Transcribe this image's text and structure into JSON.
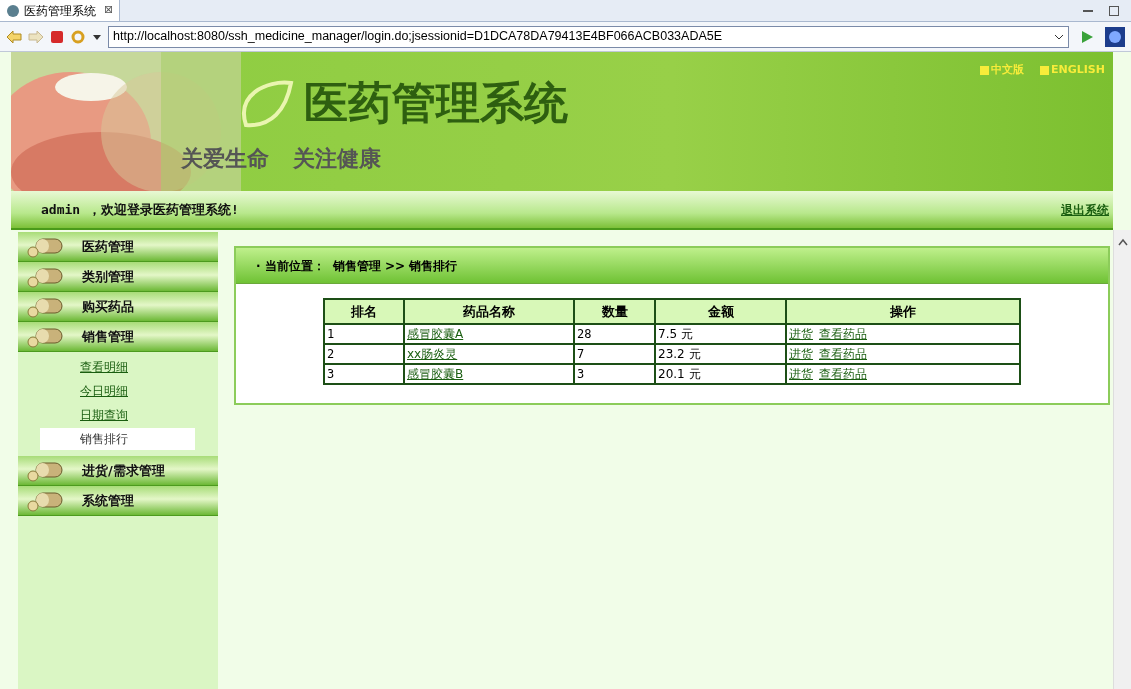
{
  "browser": {
    "tab_title": "医药管理系统",
    "tab_close": "⊠",
    "address": "http://localhost:8080/ssh_medicine_manager/login.do;jsessionid=D1DCA78DA79413E4BF066ACB033ADA5E"
  },
  "banner": {
    "title": "医药管理系统",
    "slogans": [
      "关爱生命",
      "关注健康"
    ],
    "languages": [
      "中文版",
      "ENGLISH"
    ]
  },
  "welcome_bar": {
    "message": "admin ，欢迎登录医药管理系统!",
    "logout": "退出系统"
  },
  "sidebar": {
    "items": [
      {
        "label": "医药管理"
      },
      {
        "label": "类别管理"
      },
      {
        "label": "购买药品"
      },
      {
        "label": "销售管理",
        "children": [
          {
            "label": "查看明细",
            "selected": false
          },
          {
            "label": "今日明细",
            "selected": false
          },
          {
            "label": "日期查询",
            "selected": false
          },
          {
            "label": "销售排行",
            "selected": true
          }
        ]
      },
      {
        "label": "进货/需求管理"
      },
      {
        "label": "系统管理"
      }
    ]
  },
  "breadcrumb": {
    "prefix": "· 当前位置：",
    "path": "销售管理 >> 销售排行"
  },
  "table": {
    "columns": [
      "排名",
      "药品名称",
      "数量",
      "金额",
      "操作"
    ],
    "rows": [
      {
        "rank": "1",
        "name": "感冒胶囊A",
        "quantity": "28",
        "amount": "7.5 元",
        "actions": [
          "进货",
          "查看药品"
        ]
      },
      {
        "rank": "2",
        "name": "xx肠炎灵",
        "quantity": "7",
        "amount": "23.2 元",
        "actions": [
          "进货",
          "查看药品"
        ]
      },
      {
        "rank": "3",
        "name": "感冒胶囊B",
        "quantity": "3",
        "amount": "20.1 元",
        "actions": [
          "进货",
          "查看药品"
        ]
      }
    ]
  }
}
